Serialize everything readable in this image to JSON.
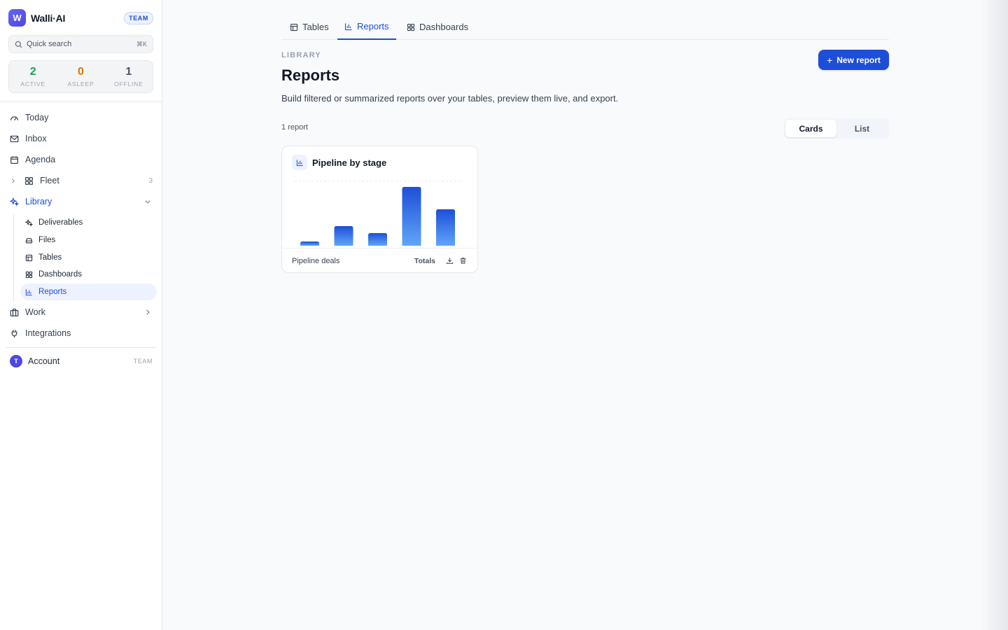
{
  "brand": {
    "logo_letter": "W",
    "name": "Walli·AI",
    "badge": "TEAM"
  },
  "search": {
    "placeholder": "Quick search",
    "shortcut": "⌘K"
  },
  "stats": [
    {
      "value": "2",
      "label": "ACTIVE",
      "color": "#16a34a"
    },
    {
      "value": "0",
      "label": "ASLEEP",
      "color": "#d97706"
    },
    {
      "value": "1",
      "label": "OFFLINE",
      "color": "#4b5563"
    }
  ],
  "nav": {
    "today": "Today",
    "inbox": "Inbox",
    "agenda": "Agenda",
    "fleet": {
      "label": "Fleet",
      "count": "3"
    },
    "library": "Library",
    "library_items": [
      "Deliverables",
      "Files",
      "Tables",
      "Dashboards",
      "Reports"
    ],
    "work": "Work",
    "integrations": "Integrations"
  },
  "account": {
    "avatar": "T",
    "label": "Account",
    "badge": "TEAM"
  },
  "tabs": [
    "Tables",
    "Reports",
    "Dashboards"
  ],
  "page": {
    "eyebrow": "LIBRARY",
    "title": "Reports",
    "description": "Build filtered or summarized reports over your tables, preview them live, and export.",
    "new_button": "New report",
    "count": "1 report",
    "view_options": [
      "Cards",
      "List"
    ]
  },
  "report_card": {
    "title": "Pipeline by stage",
    "source": "Pipeline deals",
    "mode": "Totals"
  },
  "chart_data": {
    "type": "bar",
    "categories": [
      "",
      "",
      "",
      "",
      ""
    ],
    "values": [
      6,
      28,
      18,
      84,
      52
    ],
    "ylim": [
      0,
      92
    ],
    "title": "",
    "xlabel": "",
    "ylabel": "",
    "grid": false
  },
  "colors": {
    "accent": "#1d4ed8",
    "bar_top": "#1d4ed8",
    "bar_bottom": "#60a5fa"
  }
}
